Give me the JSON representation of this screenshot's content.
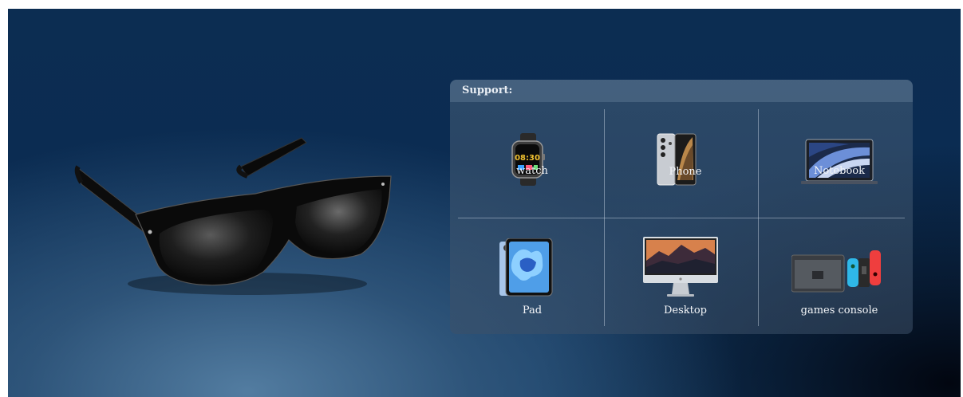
{
  "support": {
    "title": "Support:",
    "devices": [
      {
        "label": "watch",
        "icon": "smartwatch-icon"
      },
      {
        "label": "Phone",
        "icon": "smartphone-icon"
      },
      {
        "label": "Notebook",
        "icon": "laptop-icon"
      },
      {
        "label": "Pad",
        "icon": "tablet-icon"
      },
      {
        "label": "Desktop",
        "icon": "desktop-computer-icon"
      },
      {
        "label": "games console",
        "icon": "game-console-icon"
      }
    ],
    "watch_time": "08:30"
  },
  "colors": {
    "background_top": "#0b2c52",
    "panel": "#3c5068",
    "text": "#f3f5f8"
  }
}
